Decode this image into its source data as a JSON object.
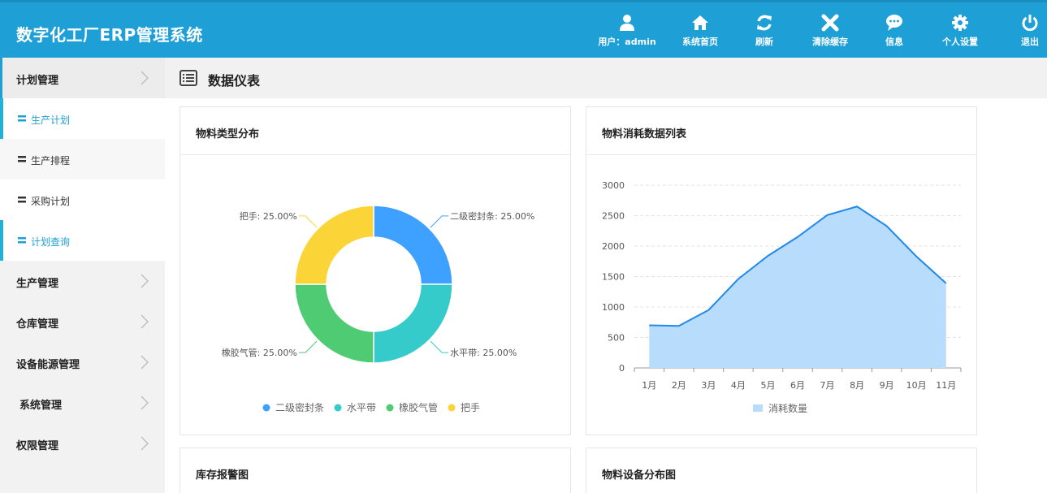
{
  "app": {
    "title": "数字化工厂ERP管理系统"
  },
  "nav": [
    {
      "label": "用户：admin",
      "icon": "user-icon"
    },
    {
      "label": "系统首页",
      "icon": "home-icon"
    },
    {
      "label": "刷新",
      "icon": "refresh-icon"
    },
    {
      "label": "清除缓存",
      "icon": "close-icon"
    },
    {
      "label": "信息",
      "icon": "message-icon"
    },
    {
      "label": "个人设置",
      "icon": "gear-icon"
    },
    {
      "label": "退出",
      "icon": "power-icon"
    }
  ],
  "sidebar": {
    "groups": [
      {
        "label": "计划管理"
      },
      {
        "label": "生产管理"
      },
      {
        "label": "仓库管理"
      },
      {
        "label": "设备能源管理"
      },
      {
        "label": "系统管理"
      },
      {
        "label": "权限管理"
      }
    ],
    "sub_items": [
      {
        "label": "生产计划",
        "active": true
      },
      {
        "label": "生产排程",
        "active": false
      },
      {
        "label": "采购计划",
        "active": false
      },
      {
        "label": "计划查询",
        "active": true
      }
    ]
  },
  "content": {
    "title": "数据仪表"
  },
  "cards": {
    "material_types": {
      "title": "物料类型分布"
    },
    "consumption": {
      "title": "物料消耗数据列表"
    },
    "stock_alert": {
      "title": "库存报警图"
    },
    "equipment": {
      "title": "物料设备分布图"
    }
  },
  "chart_data": [
    {
      "type": "pie",
      "categories": [
        "二级密封条",
        "水平带",
        "橡胶气管",
        "把手"
      ],
      "values": [
        25,
        25,
        25,
        25
      ],
      "labels": [
        "二级密封条: 25.00%",
        "水平带: 25.00%",
        "橡胶气管: 25.00%",
        "把手: 25.00%"
      ],
      "colors": [
        "#3fa1ff",
        "#36cbcb",
        "#4ecb73",
        "#fbd437"
      ],
      "legend": "bottom"
    },
    {
      "type": "area",
      "x": [
        "1月",
        "2月",
        "3月",
        "4月",
        "5月",
        "6月",
        "7月",
        "8月",
        "9月",
        "10月",
        "11月"
      ],
      "series": [
        {
          "name": "消耗数量",
          "values": [
            700,
            690,
            950,
            1460,
            1840,
            2150,
            2510,
            2650,
            2330,
            1830,
            1390
          ]
        }
      ],
      "ylim": [
        0,
        3000
      ],
      "yticks": [
        0,
        500,
        1000,
        1500,
        2000,
        2500,
        3000
      ],
      "grid": true,
      "legend": "bottom",
      "line_color": "#2189e8",
      "fill_color": "#b8dcfb"
    }
  ]
}
